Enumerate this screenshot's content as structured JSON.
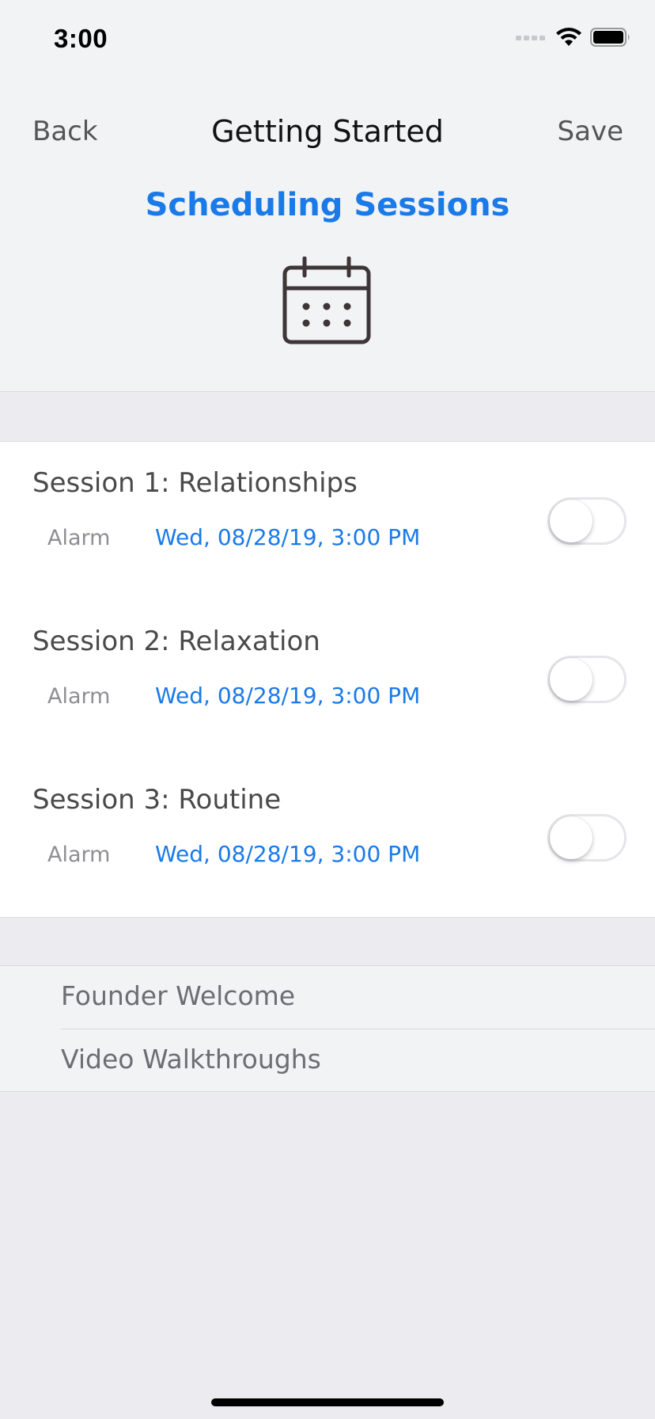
{
  "status_bar": {
    "time": "3:00"
  },
  "nav": {
    "back_label": "Back",
    "title": "Getting Started",
    "save_label": "Save"
  },
  "header": {
    "section_title": "Scheduling Sessions",
    "icon": "calendar-icon"
  },
  "sessions": [
    {
      "title": "Session 1: Relationships",
      "alarm_label": "Alarm",
      "alarm_datetime": "Wed, 08/28/19, 3:00 PM",
      "enabled": false
    },
    {
      "title": "Session 2: Relaxation",
      "alarm_label": "Alarm",
      "alarm_datetime": "Wed, 08/28/19, 3:00 PM",
      "enabled": false
    },
    {
      "title": "Session 3: Routine",
      "alarm_label": "Alarm",
      "alarm_datetime": "Wed, 08/28/19, 3:00 PM",
      "enabled": false
    }
  ],
  "links": [
    {
      "label": "Founder Welcome"
    },
    {
      "label": "Video Walkthroughs"
    }
  ],
  "colors": {
    "accent": "#1a7ae8",
    "background": "#ececf0",
    "header_background": "#f2f3f5",
    "text_primary": "#4a4a4a",
    "text_secondary": "#8e8e93"
  }
}
